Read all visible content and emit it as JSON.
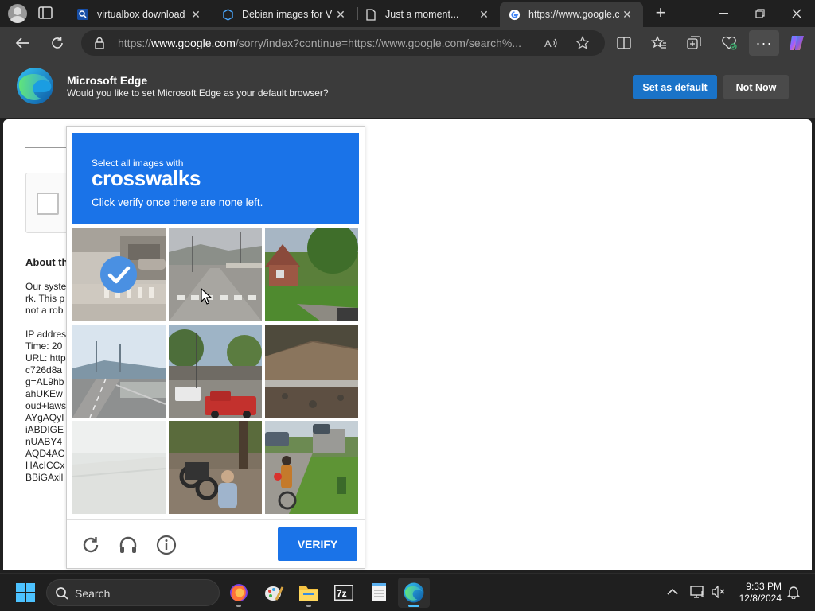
{
  "tabs": [
    {
      "label": "virtualbox download on",
      "icon": "search-favicon"
    },
    {
      "label": "Debian images for VM",
      "icon": "globe-favicon"
    },
    {
      "label": "Just a moment...",
      "icon": "page-favicon"
    },
    {
      "label": "https://www.google.co",
      "icon": "google-favicon",
      "active": true
    }
  ],
  "address_bar": {
    "url_prefix": "https://",
    "url_domain": "www.google.com",
    "url_rest": "/sorry/index?continue=https://www.google.com/search%..."
  },
  "infobar": {
    "title": "Microsoft Edge",
    "message": "Would you like to set Microsoft Edge as your default browser?",
    "set_default_label": "Set as default",
    "not_now_label": "Not Now"
  },
  "page": {
    "about_heading": "About th",
    "text_lines": "Our syste\nrk. This p\nnot a rob\n\nIP addres\nTime: 20\nURL: http\nc726d8a\ng=AL9hb\nahUKEw\noud+laws\nAYgAQyI\niABDIGE\nnUABY4\nAQD4AC\nHAcICCx\nBBiGAxil"
  },
  "captcha": {
    "instruction_line1": "Select all images with",
    "target_word": "crosswalks",
    "instruction_line3": "Click verify once there are none left.",
    "verify_label": "VERIFY",
    "selected_tiles": [
      0
    ]
  },
  "taskbar": {
    "search_label": "Search",
    "time": "9:33 PM",
    "date": "12/8/2024"
  },
  "colors": {
    "captcha_blue": "#1a73e8",
    "edge_default_button": "#1a73c8"
  }
}
